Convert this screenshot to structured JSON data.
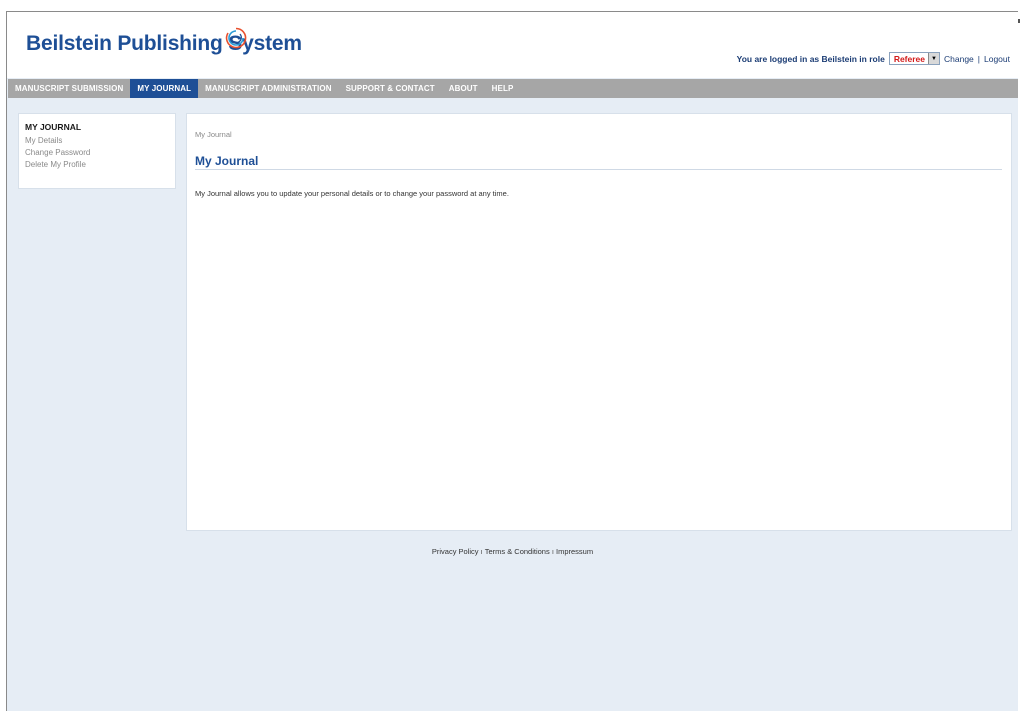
{
  "header": {
    "brand": "Beilstein Publishing System",
    "logo_icon": "swirl-logo-icon",
    "login": {
      "text": "You are logged in as Beilstein in role",
      "role": "Referee",
      "change": "Change",
      "separator": "|",
      "logout": "Logout"
    }
  },
  "nav": {
    "items": [
      {
        "label": "Manuscript Submission"
      },
      {
        "label": "My Journal"
      },
      {
        "label": "Manuscript Administration"
      },
      {
        "label": "Support & Contact"
      },
      {
        "label": "About"
      },
      {
        "label": "Help"
      }
    ],
    "active": "My Journal"
  },
  "sidebar": {
    "title": "MY JOURNAL",
    "items": [
      {
        "label": "My Details"
      },
      {
        "label": "Change Password"
      },
      {
        "label": "Delete My Profile"
      }
    ]
  },
  "main": {
    "breadcrumb": "My Journal",
    "title": "My Journal",
    "intro": "My Journal allows you to update your personal details or to change your password at any time."
  },
  "footer": {
    "links": [
      {
        "label": "Privacy Policy"
      },
      {
        "label": "Terms & Conditions"
      },
      {
        "label": "Impressum"
      }
    ],
    "separator": "ı"
  },
  "colors": {
    "brand_blue": "#1e4f96",
    "nav_gray": "#a6a6a6",
    "page_bg": "#e6edf5",
    "role_red": "#d21a1a"
  }
}
